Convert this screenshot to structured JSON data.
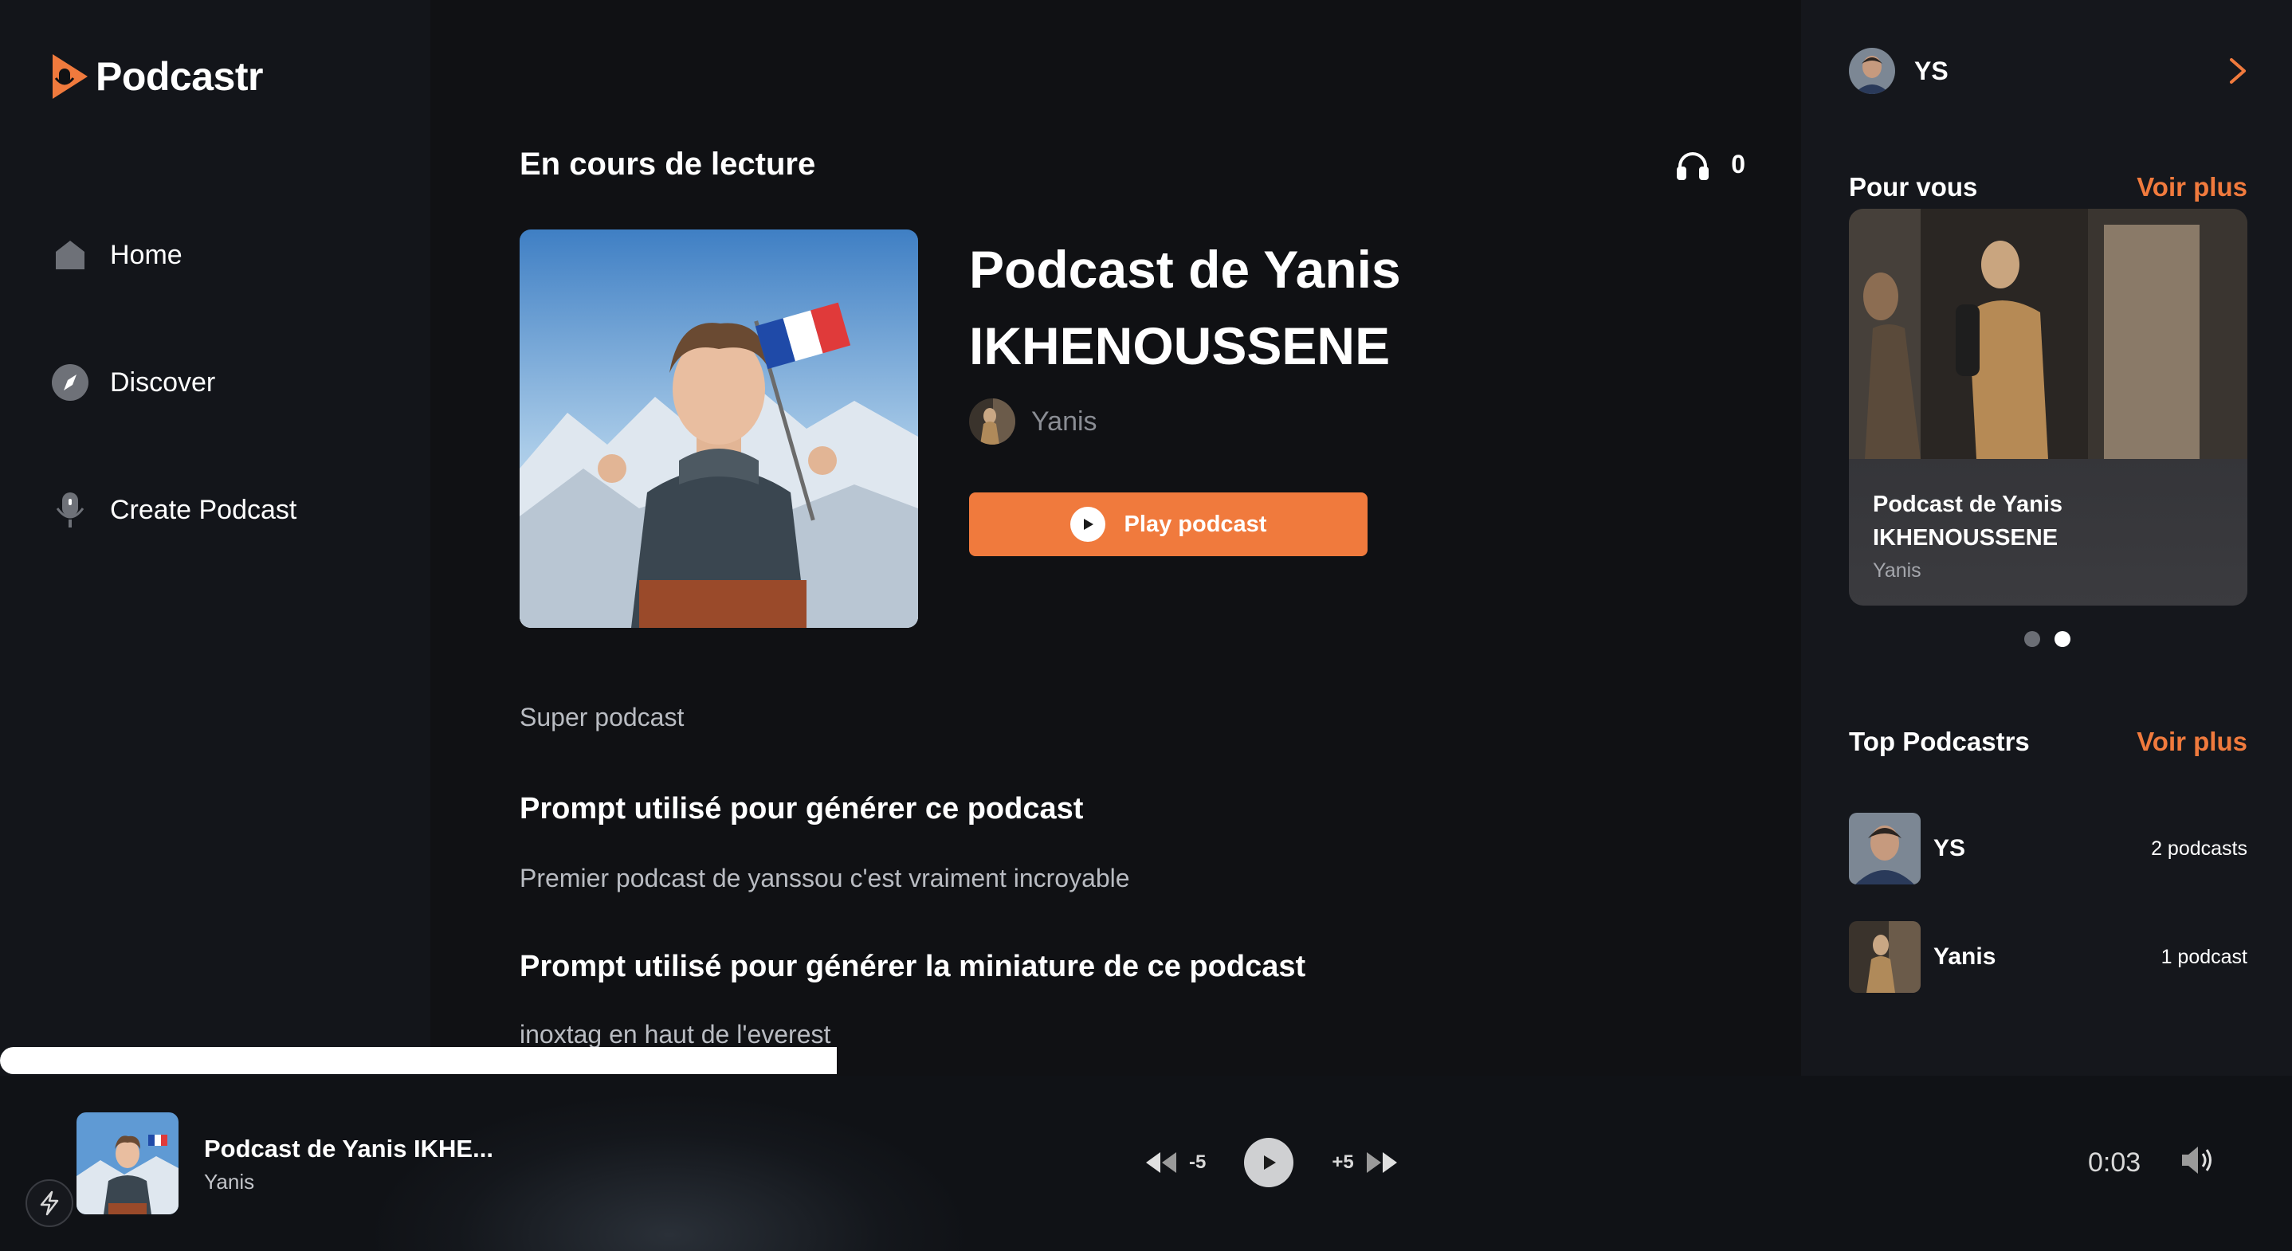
{
  "app": {
    "name": "Podcastr",
    "accent": "#f07a3d"
  },
  "sidebar": {
    "items": [
      {
        "label": "Home",
        "icon": "home-icon"
      },
      {
        "label": "Discover",
        "icon": "compass-icon"
      },
      {
        "label": "Create Podcast",
        "icon": "microphone-icon"
      }
    ]
  },
  "main": {
    "section_title": "En cours de lecture",
    "listen_count": "0",
    "podcast_title": "Podcast de Yanis IKHENOUSSENE",
    "author": "Yanis",
    "play_label": "Play podcast",
    "description": "Super podcast",
    "prompt_heading": "Prompt utilisé pour générer ce podcast",
    "prompt_text": "Premier podcast de yanssou c'est vraiment incroyable",
    "thumbnail_prompt_heading": "Prompt utilisé pour générer la miniature de ce podcast",
    "thumbnail_prompt_text": "inoxtag en haut de l'everest"
  },
  "right": {
    "user_initials": "YS",
    "for_you_title": "Pour vous",
    "see_more": "Voir plus",
    "card": {
      "title": "Podcast de Yanis IKHENOUSSENE",
      "author": "Yanis"
    },
    "carousel_active_index": 1,
    "top_title": "Top Podcastrs",
    "top": [
      {
        "name": "YS",
        "count": "2 podcasts"
      },
      {
        "name": "Yanis",
        "count": "1 podcast"
      }
    ]
  },
  "player": {
    "title": "Podcast de Yanis IKHE...",
    "author": "Yanis",
    "rewind_label": "-5",
    "forward_label": "+5",
    "time": "0:03",
    "progress": 0.365
  }
}
